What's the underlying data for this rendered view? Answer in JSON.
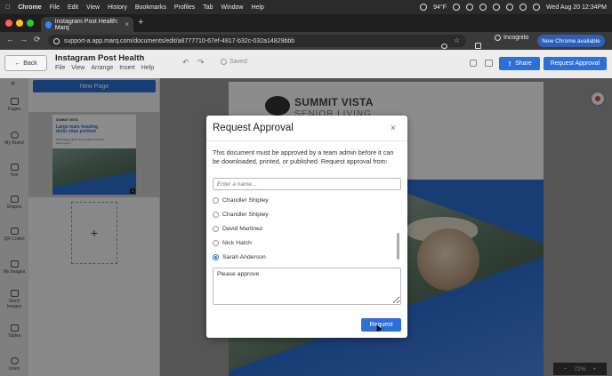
{
  "os_menubar": {
    "apple": "",
    "app": "Chrome",
    "items": [
      "File",
      "Edit",
      "View",
      "History",
      "Bookmarks",
      "Profiles",
      "Tab",
      "Window",
      "Help"
    ],
    "weather": "94°F",
    "datetime": "Wed Aug 20  12:34PM"
  },
  "browser": {
    "tab_title": "Instagram Post Health: Marq",
    "tab_close": "×",
    "new_tab": "+",
    "url": "support-a.app.marq.com/documents/edit/a8777710-67ef-4817-b32c-032a14829bbb",
    "incognito": "Incognito",
    "new_chrome": "New Chrome available",
    "nav_back": "←",
    "nav_forward": "→",
    "nav_reload": "⟳"
  },
  "app_header": {
    "back": "Back",
    "doc_title": "Instagram Post Health",
    "menu": [
      "File",
      "View",
      "Arrange",
      "Insert",
      "Help"
    ],
    "saved": "Saved",
    "share": "Share",
    "request_approval": "Request Approval"
  },
  "left_rail": [
    {
      "label": "Pages",
      "icon": "pages-icon"
    },
    {
      "label": "My Brand",
      "icon": "palette-icon"
    },
    {
      "label": "Text",
      "icon": "text-icon"
    },
    {
      "label": "Shapes",
      "icon": "shapes-icon"
    },
    {
      "label": "QR Codes",
      "icon": "qr-icon"
    },
    {
      "label": "My Images",
      "icon": "folder-icon"
    },
    {
      "label": "Stock Images",
      "icon": "image-icon"
    },
    {
      "label": "Tables",
      "icon": "table-icon"
    },
    {
      "label": "Users",
      "icon": "user-icon"
    }
  ],
  "pages_panel": {
    "new_page": "New Page",
    "thumb_brand": "SUMMIT VISTA",
    "thumb_heading": "Large main heading dolor vitae pretium",
    "thumb_sub": "Subheading dolor vitae pretium tincidunt lorem ipsum",
    "page_number": "1",
    "add_page": "+"
  },
  "canvas": {
    "brand_line1": "SUMMIT VISTA",
    "brand_line2": "SENIOR LIVING",
    "zoom": "72%",
    "zoom_minus": "−",
    "zoom_plus": "+"
  },
  "dialog": {
    "title": "Request Approval",
    "close": "×",
    "message": "This document must be approved by a team admin before it can be downloaded, printed, or published. Request approval from:",
    "name_placeholder": "Enter a name...",
    "options": [
      {
        "name": "Chandler Shipley",
        "selected": false
      },
      {
        "name": "Chandler Shipley",
        "selected": false
      },
      {
        "name": "David Martinez",
        "selected": false
      },
      {
        "name": "Nick Hatch",
        "selected": false
      },
      {
        "name": "Sarah Anderson",
        "selected": true
      }
    ],
    "note": "Please approve",
    "submit": "Request"
  },
  "colors": {
    "accent": "#2c6fd6",
    "menubar": "#2b2b2b",
    "overlay": "rgba(0,0,0,0.45)"
  }
}
